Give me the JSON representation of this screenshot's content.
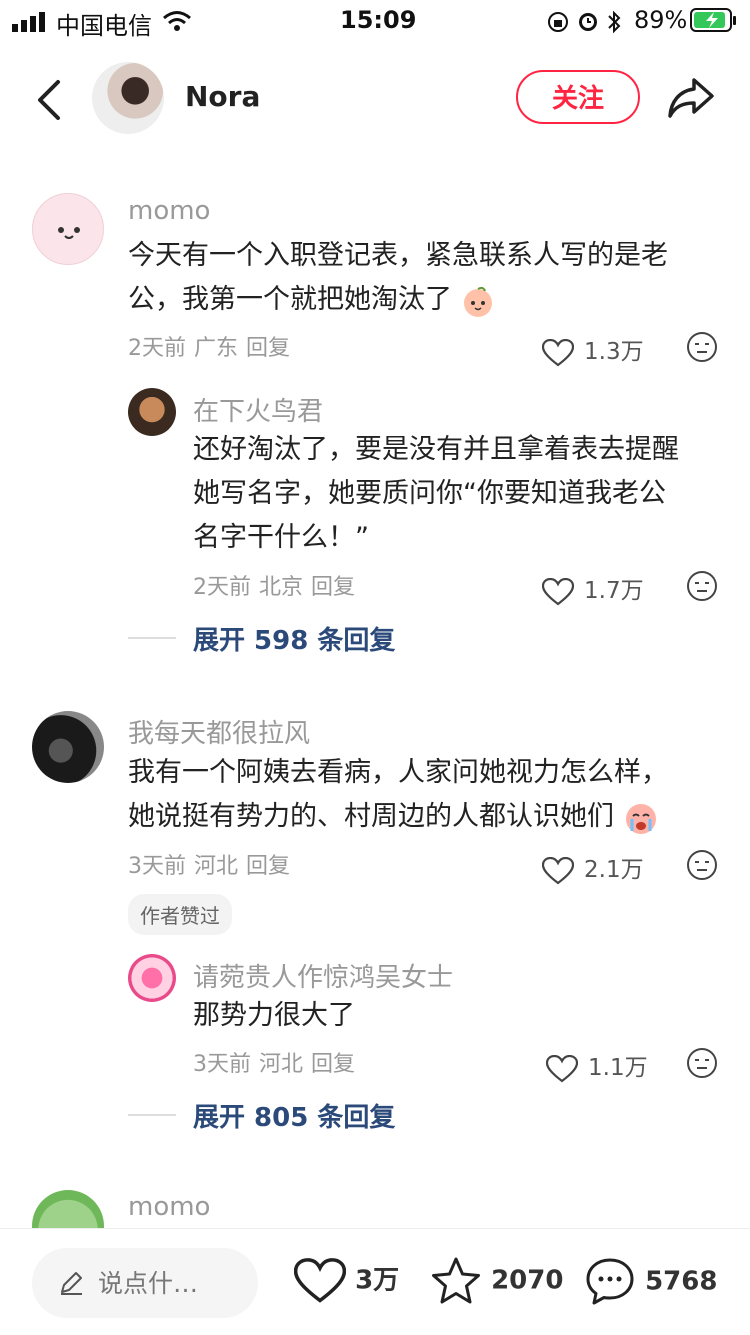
{
  "status": {
    "carrier": "中国电信",
    "time": "15:09",
    "battery": "89%"
  },
  "header": {
    "author": "Nora",
    "follow_label": "关注"
  },
  "comments": [
    {
      "user": "momo",
      "text_line1": "今天有一个入职登记表，紧急联系人写的是老",
      "text_line2": "公，我第一个就把她淘汰了",
      "time": "2天前",
      "location": "广东",
      "reply": "回复",
      "likes": "1.3万",
      "replies": [
        {
          "user": "在下火鸟君",
          "text_line1": "还好淘汰了，要是没有并且拿着表去提醒",
          "text_line2": "她写名字，她要质问你“你要知道我老公",
          "text_line3": "名字干什么！”",
          "time": "2天前",
          "location": "北京",
          "reply": "回复",
          "likes": "1.7万"
        }
      ],
      "expand": "展开 598 条回复"
    },
    {
      "user": "我每天都很拉风",
      "text_line1": "我有一个阿姨去看病，人家问她视力怎么样，",
      "text_line2": "她说挺有势力的、村周边的人都认识她们",
      "time": "3天前",
      "location": "河北",
      "reply": "回复",
      "likes": "2.1万",
      "tag": "作者赞过",
      "replies": [
        {
          "user": "请菀贵人作惊鸿吴女士",
          "text_line1": "那势力很大了",
          "time": "3天前",
          "location": "河北",
          "reply": "回复",
          "likes": "1.1万"
        }
      ],
      "expand": "展开 805 条回复"
    },
    {
      "user": "momo"
    }
  ],
  "bottom": {
    "placeholder": "说点什…",
    "likes": "3万",
    "favorites": "2070",
    "comments": "5768"
  },
  "colors": {
    "accent": "#ff2442",
    "expand": "#2b4a7a"
  }
}
